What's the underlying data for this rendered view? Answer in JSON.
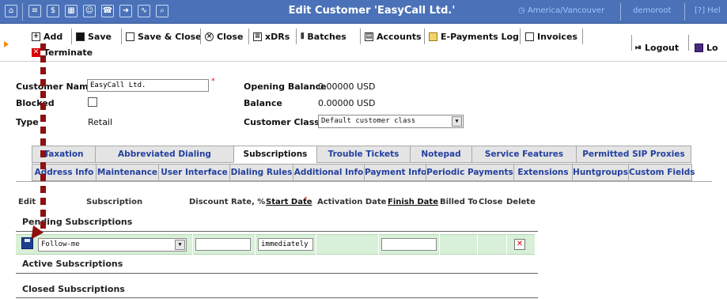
{
  "window": {
    "title": "Edit Customer 'EasyCall Ltd.'",
    "timezone": "America/Vancouver",
    "user": "demoroot",
    "help_label": "Hel",
    "nav_icons": [
      "home-icon",
      "list-icon",
      "dollar-icon",
      "grid-icon",
      "person-icon",
      "phone-icon",
      "arrow-icon",
      "chart-icon",
      "search-icon"
    ]
  },
  "toolbar": {
    "add": "Add",
    "save": "Save",
    "save_close": "Save & Close",
    "close": "Close",
    "xdrs": "xDRs",
    "batches": "Batches",
    "accounts": "Accounts",
    "epayments": "E-Payments Log",
    "invoices": "Invoices",
    "terminate": "Terminate",
    "logout": "Logout",
    "log": "Lo"
  },
  "form": {
    "customer_name_label": "Customer Name",
    "customer_name_value": "EasyCall Ltd.",
    "blocked_label": "Blocked",
    "type_label": "Type",
    "type_value": "Retail",
    "opening_balance_label": "Opening Balance",
    "opening_balance_value": "0.00000 USD",
    "balance_label": "Balance",
    "balance_value": "0.00000 USD",
    "customer_class_label": "Customer Class",
    "customer_class_value": "Default customer class"
  },
  "tabs_row1": [
    "Taxation",
    "Abbreviated Dialing",
    "Subscriptions",
    "Trouble Tickets",
    "Notepad",
    "Service Features",
    "Permitted SIP Proxies"
  ],
  "tabs_row2": [
    "Address Info",
    "Maintenance",
    "User Interface",
    "Dialing Rules",
    "Additional Info",
    "Payment Info",
    "Periodic Payments",
    "Extensions",
    "Huntgroups",
    "Custom Fields"
  ],
  "active_tab": "Subscriptions",
  "subscriptions": {
    "columns": {
      "edit": "Edit",
      "subscription": "Subscription",
      "discount_rate": "Discount Rate, %",
      "start_date": "Start Date",
      "activation_date": "Activation Date",
      "finish_date": "Finish Date",
      "billed_to": "Billed To",
      "close": "Close",
      "delete": "Delete"
    },
    "pending_heading": "Pending Subscriptions",
    "active_heading": "Active Subscriptions",
    "closed_heading": "Closed Subscriptions",
    "new_row": {
      "subscription_value": "Follow-me",
      "discount_value": "",
      "start_value": "immediately",
      "finish_value": ""
    }
  },
  "colors": {
    "titlebar": "#4b72b8",
    "link_blue": "#23409f",
    "row_green": "#d8efd8",
    "annotation_red": "#8e1010"
  }
}
